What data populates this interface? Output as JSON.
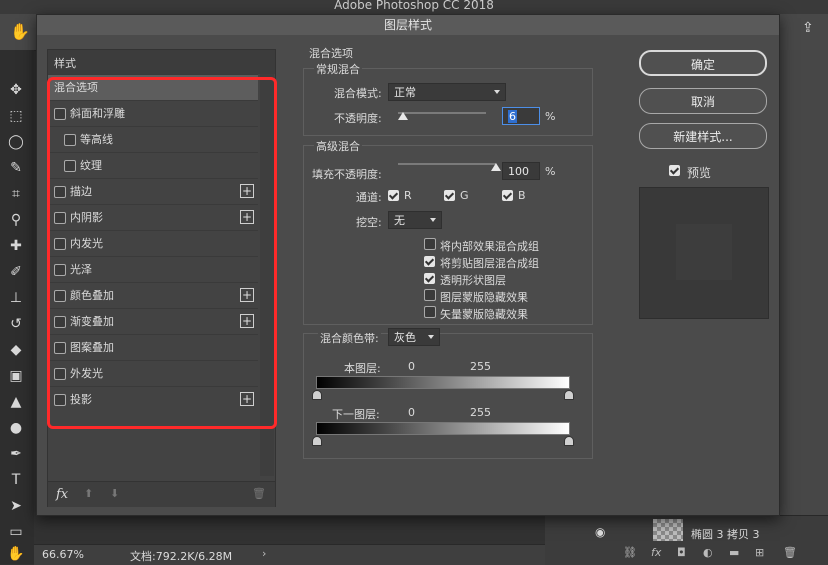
{
  "app": {
    "title": "Adobe Photoshop CC 2018",
    "status_zoom": "66.67%",
    "status_doc": "文档:792.2K/6.28M",
    "layer_name": "椭圆 3 拷贝 3"
  },
  "dialog": {
    "title": "图层样式",
    "styles_header": "样式",
    "styles": [
      {
        "label": "混合选项",
        "checkbox": false,
        "plus": false
      },
      {
        "label": "斜面和浮雕",
        "checkbox": true,
        "plus": false
      },
      {
        "label": "等高线",
        "checkbox": true,
        "plus": false
      },
      {
        "label": "纹理",
        "checkbox": true,
        "plus": false
      },
      {
        "label": "描边",
        "checkbox": true,
        "plus": true
      },
      {
        "label": "内阴影",
        "checkbox": true,
        "plus": true
      },
      {
        "label": "内发光",
        "checkbox": true,
        "plus": false
      },
      {
        "label": "光泽",
        "checkbox": true,
        "plus": false
      },
      {
        "label": "颜色叠加",
        "checkbox": true,
        "plus": true
      },
      {
        "label": "渐变叠加",
        "checkbox": true,
        "plus": true
      },
      {
        "label": "图案叠加",
        "checkbox": true,
        "plus": false
      },
      {
        "label": "外发光",
        "checkbox": true,
        "plus": false
      },
      {
        "label": "投影",
        "checkbox": true,
        "plus": true
      }
    ],
    "fx_label": "fx",
    "blend": {
      "section_title": "混合选项",
      "general_title": "常规混合",
      "mode_label": "混合模式:",
      "mode_value": "正常",
      "opacity_label": "不透明度:",
      "opacity_value": "6",
      "percent": "%",
      "opacity_level": 0.06
    },
    "advanced": {
      "title": "高级混合",
      "fill_label": "填充不透明度:",
      "fill_value": "100",
      "percent": "%",
      "fill_level": 1.0,
      "channels_label": "通道:",
      "ch_r": "R",
      "ch_g": "G",
      "ch_b": "B",
      "knockout_label": "挖空:",
      "knockout_value": "无",
      "options": [
        {
          "label": "将内部效果混合成组",
          "checked": false
        },
        {
          "label": "将剪贴图层混合成组",
          "checked": true
        },
        {
          "label": "透明形状图层",
          "checked": true
        },
        {
          "label": "图层蒙版隐藏效果",
          "checked": false
        },
        {
          "label": "矢量蒙版隐藏效果",
          "checked": false
        }
      ]
    },
    "blendif": {
      "label": "混合颜色带:",
      "value": "灰色",
      "this_layer": "本图层:",
      "this_min": "0",
      "this_max": "255",
      "under_layer": "下一图层:",
      "under_min": "0",
      "under_max": "255"
    },
    "buttons": {
      "ok": "确定",
      "cancel": "取消",
      "new_style": "新建样式...",
      "preview": "预览"
    }
  }
}
